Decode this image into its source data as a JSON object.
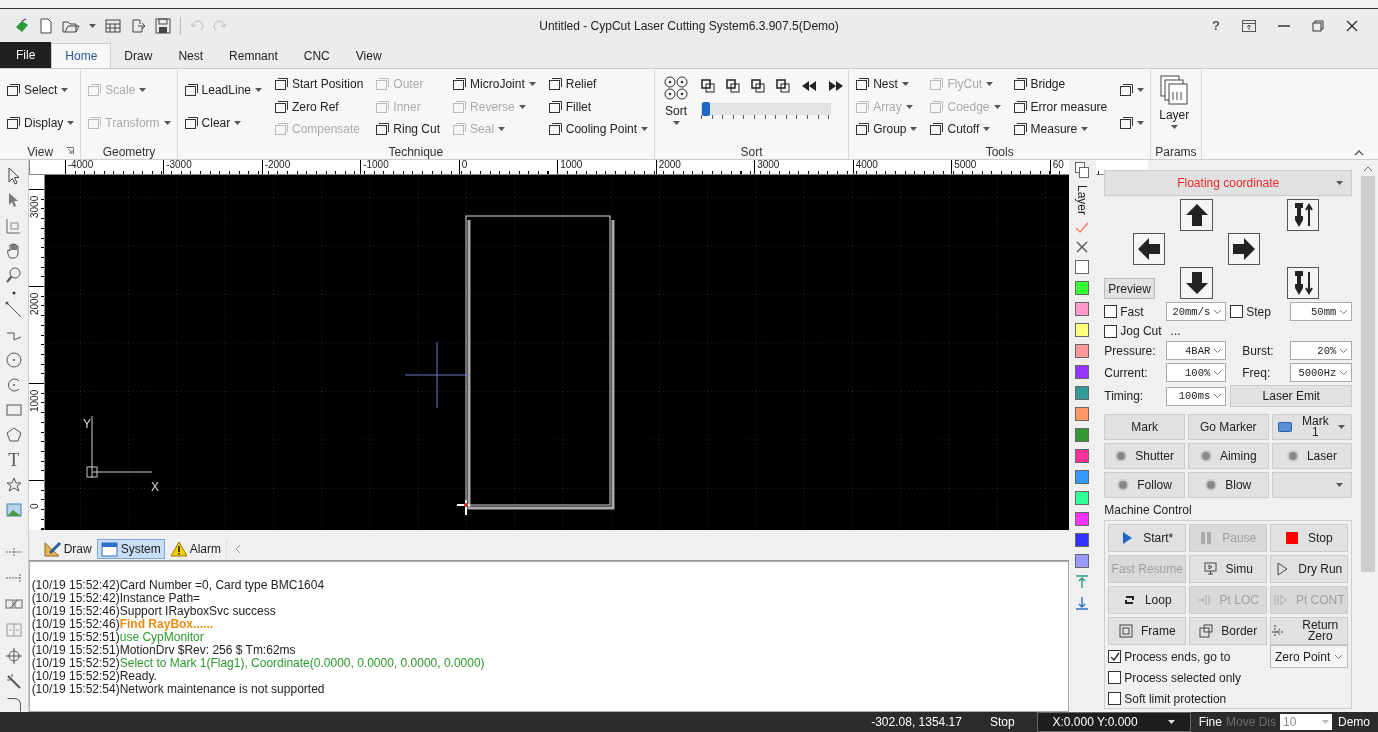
{
  "title_bar": {
    "title": "Untitled - CypCut Laser Cutting System6.3.907.5(Demo)",
    "help": "?"
  },
  "menu_tabs": [
    {
      "label": "File",
      "kind": "file",
      "selected": false
    },
    {
      "label": "Home",
      "kind": "tab",
      "selected": true
    },
    {
      "label": "Draw",
      "kind": "tab",
      "selected": false
    },
    {
      "label": "Nest",
      "kind": "tab",
      "selected": false
    },
    {
      "label": "Remnant",
      "kind": "tab",
      "selected": false
    },
    {
      "label": "CNC",
      "kind": "tab",
      "selected": false
    },
    {
      "label": "View",
      "kind": "tab",
      "selected": false
    }
  ],
  "ribbon": {
    "groups": [
      {
        "label": "View",
        "kind": "columns",
        "launcher": true,
        "columns": [
          [
            {
              "label": "Select",
              "dropdown": true,
              "disabled": false
            },
            {
              "label": "Display",
              "dropdown": true,
              "disabled": false
            }
          ]
        ]
      },
      {
        "label": "Geometry",
        "kind": "columns",
        "columns": [
          [
            {
              "label": "Scale",
              "dropdown": true,
              "disabled": true
            },
            {
              "label": "Transform",
              "dropdown": true,
              "disabled": true
            }
          ]
        ]
      },
      {
        "label": "Technique",
        "kind": "columns",
        "columns": [
          [
            {
              "label": "LeadLine",
              "dropdown": true,
              "disabled": false
            },
            {
              "label": "Clear",
              "dropdown": true,
              "disabled": false
            }
          ],
          [
            {
              "label": "Start Position",
              "dropdown": false,
              "disabled": false
            },
            {
              "label": "Zero Ref",
              "dropdown": false,
              "disabled": false
            },
            {
              "label": "Compensate",
              "dropdown": false,
              "disabled": true
            }
          ],
          [
            {
              "label": "Outer",
              "dropdown": false,
              "disabled": true
            },
            {
              "label": "Inner",
              "dropdown": false,
              "disabled": true
            },
            {
              "label": "Ring Cut",
              "dropdown": false,
              "disabled": false
            }
          ],
          [
            {
              "label": "MicroJoint",
              "dropdown": true,
              "disabled": false
            },
            {
              "label": "Reverse",
              "dropdown": true,
              "disabled": true
            },
            {
              "label": "Seal",
              "dropdown": true,
              "disabled": true
            }
          ],
          [
            {
              "label": "Relief",
              "dropdown": false,
              "disabled": false
            },
            {
              "label": "Fillet",
              "dropdown": false,
              "disabled": false
            },
            {
              "label": "Cooling Point",
              "dropdown": true,
              "disabled": false
            }
          ]
        ]
      },
      {
        "label": "Sort",
        "kind": "sort",
        "button": "Sort",
        "slider": {
          "level": 0
        }
      },
      {
        "label": "Tools",
        "kind": "columns",
        "columns": [
          [
            {
              "label": "Nest",
              "dropdown": true,
              "disabled": false
            },
            {
              "label": "Array",
              "dropdown": true,
              "disabled": true
            },
            {
              "label": "Group",
              "dropdown": true,
              "disabled": false
            }
          ],
          [
            {
              "label": "FlyCut",
              "dropdown": true,
              "disabled": true
            },
            {
              "label": "Coedge",
              "dropdown": true,
              "disabled": true
            },
            {
              "label": "Cutoff",
              "dropdown": true,
              "disabled": false
            }
          ],
          [
            {
              "label": "Bridge",
              "dropdown": false,
              "disabled": false
            },
            {
              "label": "Error measure",
              "dropdown": false,
              "disabled": false
            },
            {
              "label": "Measure",
              "dropdown": true,
              "disabled": false
            }
          ],
          [
            {
              "dropdown": true,
              "disabled": false
            },
            {
              "dropdown": true,
              "disabled": false
            }
          ]
        ]
      },
      {
        "label": "Params",
        "kind": "large",
        "button": "Layer"
      }
    ]
  },
  "left_toolbar": {
    "text_tool": "T"
  },
  "ruler": {
    "horizontal": [
      "-4000",
      "-3000",
      "-2000",
      "-1000",
      "0",
      "1000",
      "2000",
      "3000",
      "4000",
      "5000",
      "60"
    ],
    "vertical": [
      "3000",
      "2000",
      "1000",
      "0"
    ]
  },
  "canvas": {
    "y_axis_label": "Y",
    "x_axis_label": "X"
  },
  "log_tabs": [
    {
      "label": "Draw",
      "kind": "draw",
      "selected": false
    },
    {
      "label": "System",
      "kind": "system",
      "selected": true
    },
    {
      "label": "Alarm",
      "kind": "alarm",
      "selected": false
    }
  ],
  "log": [
    {
      "time": "(10/19 15:52:42)",
      "message": "Card Number =0, Card type BMC1604",
      "kind": "info"
    },
    {
      "time": "(10/19 15:52:42)",
      "message": "Instance Path=",
      "kind": "info"
    },
    {
      "time": "(10/19 15:52:46)",
      "message": "Support IRayboxSvc success",
      "kind": "info"
    },
    {
      "time": "(10/19 15:52:46)",
      "message": "Find RayBox......",
      "kind": "warning"
    },
    {
      "time": "(10/19 15:52:51)",
      "message": "use CypMonitor",
      "kind": "success"
    },
    {
      "time": "(10/19 15:52:51)",
      "message": "MotionDrv $Rev: 256 $ Tm:62ms",
      "kind": "info"
    },
    {
      "time": "(10/19 15:52:52)",
      "message": "Select to Mark 1(Flag1), Coordinate(0.0000, 0.0000, 0.0000, 0.0000)",
      "kind": "success"
    },
    {
      "time": "(10/19 15:52:52)",
      "message": "Ready.",
      "kind": "info"
    },
    {
      "time": "(10/19 15:52:54)",
      "message": "Network maintenance is not supported",
      "kind": "info"
    }
  ],
  "layers": {
    "label": "Layer",
    "items": [
      {
        "color": "#ffffff"
      },
      {
        "color": "#33ff33"
      },
      {
        "color": "#ff99cc"
      },
      {
        "color": "#ffff80"
      },
      {
        "color": "#ff9999"
      },
      {
        "color": "#9933ff"
      },
      {
        "color": "#339999"
      },
      {
        "color": "#ff9966"
      },
      {
        "color": "#339933"
      },
      {
        "color": "#ff3399"
      },
      {
        "color": "#3399ff"
      },
      {
        "color": "#33ff99"
      },
      {
        "color": "#ff33ff"
      },
      {
        "color": "#3333ff"
      },
      {
        "color": "#9999ff"
      }
    ]
  },
  "control_panel": {
    "coordinate_mode": "Floating coordinate",
    "preview_button": "Preview",
    "speed_row": [
      {
        "label": "Fast",
        "checked": false,
        "value": "20mm/s"
      },
      {
        "label": "Step",
        "checked": false,
        "value": "50mm"
      }
    ],
    "jog_cut": {
      "label": "Jog Cut",
      "checked": false,
      "more": "..."
    },
    "params": [
      {
        "label": "Pressure:",
        "value": "4BAR"
      },
      {
        "label": "Burst:",
        "value": "20%"
      },
      {
        "label": "Current:",
        "value": "100%"
      },
      {
        "label": "Freq:",
        "value": "5000Hz"
      },
      {
        "label": "Timing:",
        "value": "100ms"
      }
    ],
    "laser_emit_button": "Laser Emit",
    "marker_buttons": [
      {
        "label": "Mark",
        "kind": "button"
      },
      {
        "label": "Go Marker",
        "kind": "button"
      },
      {
        "label": "Mark 1",
        "kind": "dropdown"
      }
    ],
    "io_buttons": [
      {
        "label": "Shutter",
        "on": false
      },
      {
        "label": "Aiming",
        "on": false
      },
      {
        "label": "Laser",
        "on": false
      },
      {
        "label": "Follow",
        "on": false
      },
      {
        "label": "Blow",
        "on": false
      }
    ],
    "machine_control": {
      "title": "Machine Control",
      "buttons": [
        {
          "label": "Start*",
          "kind": "start",
          "disabled": false
        },
        {
          "label": "Pause",
          "kind": "pause",
          "disabled": true
        },
        {
          "label": "Stop",
          "kind": "stop",
          "disabled": false
        },
        {
          "label": "Fast Resume",
          "kind": "plain",
          "disabled": true
        },
        {
          "label": "Simu",
          "kind": "simu",
          "disabled": false
        },
        {
          "label": "Dry Run",
          "kind": "dry_run",
          "disabled": false
        },
        {
          "label": "Loop",
          "kind": "loop",
          "disabled": false
        },
        {
          "label": "Pt LOC",
          "kind": "pt_loc",
          "disabled": true
        },
        {
          "label": "Pt CONT",
          "kind": "pt_cont",
          "disabled": true
        },
        {
          "label": "Frame",
          "kind": "frame",
          "disabled": false
        },
        {
          "label": "Border",
          "kind": "border",
          "disabled": false
        },
        {
          "label": "Return Zero",
          "kind": "return_zero",
          "disabled": false
        }
      ],
      "options": [
        {
          "label": "Process ends, go to",
          "checked": true
        },
        {
          "label": "Process selected only",
          "checked": false
        },
        {
          "label": "Soft limit protection",
          "checked": false
        }
      ],
      "end_target": "Zero Point"
    }
  },
  "status_bar": {
    "coordinates": "-302.08, 1354.17",
    "state": "Stop",
    "position": "X:0.000 Y:0.000",
    "precision": "Fine",
    "move_dis": {
      "label": "Move Dis",
      "value": "10",
      "disabled": true
    },
    "mode": "Demo"
  }
}
